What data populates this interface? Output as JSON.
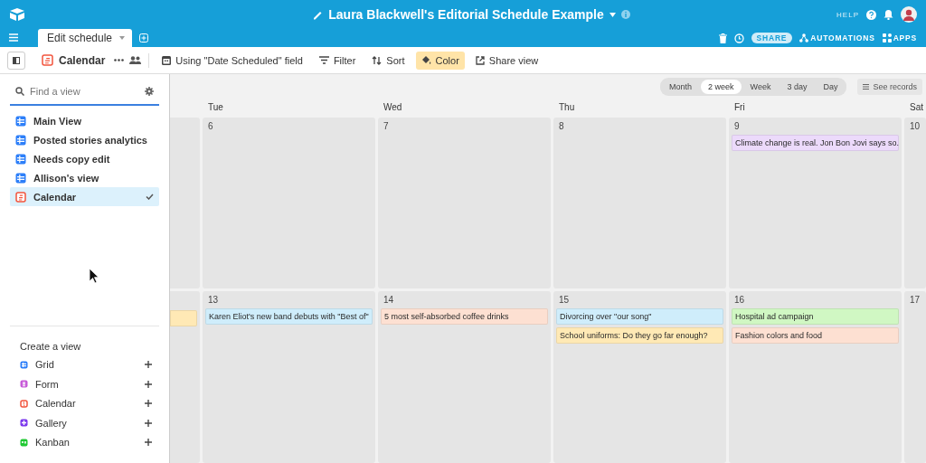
{
  "topbar": {
    "title": "Laura Blackwell's Editorial Schedule Example",
    "help": "HELP",
    "tab": {
      "label": "Edit schedule",
      "selected": true
    },
    "share": "SHARE",
    "automations": "AUTOMATIONS",
    "apps": "APPS"
  },
  "toolbar": {
    "view_name": "Calendar",
    "items": [
      {
        "kind": "date-field",
        "label": "Using \"Date Scheduled\" field",
        "selected": false
      },
      {
        "kind": "filter",
        "label": "Filter",
        "selected": false
      },
      {
        "kind": "sort",
        "label": "Sort",
        "selected": false
      },
      {
        "kind": "color",
        "label": "Color",
        "selected": true
      },
      {
        "kind": "share",
        "label": "Share view",
        "selected": false
      }
    ]
  },
  "sidebar": {
    "search": {
      "placeholder": "Find a view"
    },
    "views": [
      {
        "kind": "grid",
        "label": "Main View",
        "selected": false
      },
      {
        "kind": "grid",
        "label": "Posted stories analytics",
        "selected": false
      },
      {
        "kind": "grid",
        "label": "Needs copy edit",
        "selected": false
      },
      {
        "kind": "grid",
        "label": "Allison's view",
        "selected": false
      },
      {
        "kind": "calendar",
        "label": "Calendar",
        "selected": true
      }
    ],
    "create_title": "Create a view",
    "create": [
      {
        "kind": "grid",
        "label": "Grid"
      },
      {
        "kind": "form",
        "label": "Form"
      },
      {
        "kind": "calendar",
        "label": "Calendar"
      },
      {
        "kind": "gallery",
        "label": "Gallery"
      },
      {
        "kind": "kanban",
        "label": "Kanban"
      }
    ]
  },
  "calendar": {
    "modes": [
      {
        "label": "Month",
        "selected": false
      },
      {
        "label": "2 week",
        "selected": true
      },
      {
        "label": "Week",
        "selected": false
      },
      {
        "label": "3 day",
        "selected": false
      },
      {
        "label": "Day",
        "selected": false
      }
    ],
    "see_records": "See records",
    "day_headers": [
      "Tue",
      "Wed",
      "Thu",
      "Fri",
      "Sat"
    ],
    "weeks": [
      {
        "days": [
          {
            "kind": "partial"
          },
          {
            "kind": "day",
            "date": "6"
          },
          {
            "kind": "day",
            "date": "7"
          },
          {
            "kind": "day",
            "date": "8"
          },
          {
            "kind": "day",
            "date": "9",
            "events": [
              {
                "title": "Climate change is real. Jon Bon Jovi says so.",
                "color": "#ecdafb"
              }
            ]
          },
          {
            "kind": "partial",
            "date": "10"
          }
        ]
      },
      {
        "days": [
          {
            "kind": "partial",
            "events": [
              {
                "color": "#ffe9b5"
              }
            ]
          },
          {
            "kind": "day",
            "date": "13",
            "events": [
              {
                "title": "Karen Eliot's new band debuts with \"Best of\"",
                "color": "#cfedfb"
              }
            ]
          },
          {
            "kind": "day",
            "date": "14",
            "events": [
              {
                "title": "5 most self-absorbed coffee drinks",
                "color": "#fde0d2"
              }
            ]
          },
          {
            "kind": "day",
            "date": "15",
            "events": [
              {
                "title": "Divorcing over \"our song\"",
                "color": "#cfedfb"
              },
              {
                "title": "School uniforms: Do they go far enough?",
                "color": "#ffe9b5"
              }
            ]
          },
          {
            "kind": "day",
            "date": "16",
            "events": [
              {
                "title": "Hospital ad campaign",
                "color": "#d0f7c3"
              },
              {
                "title": "Fashion colors and food",
                "color": "#fde0d2"
              }
            ]
          },
          {
            "kind": "partial",
            "date": "17"
          }
        ]
      }
    ]
  }
}
